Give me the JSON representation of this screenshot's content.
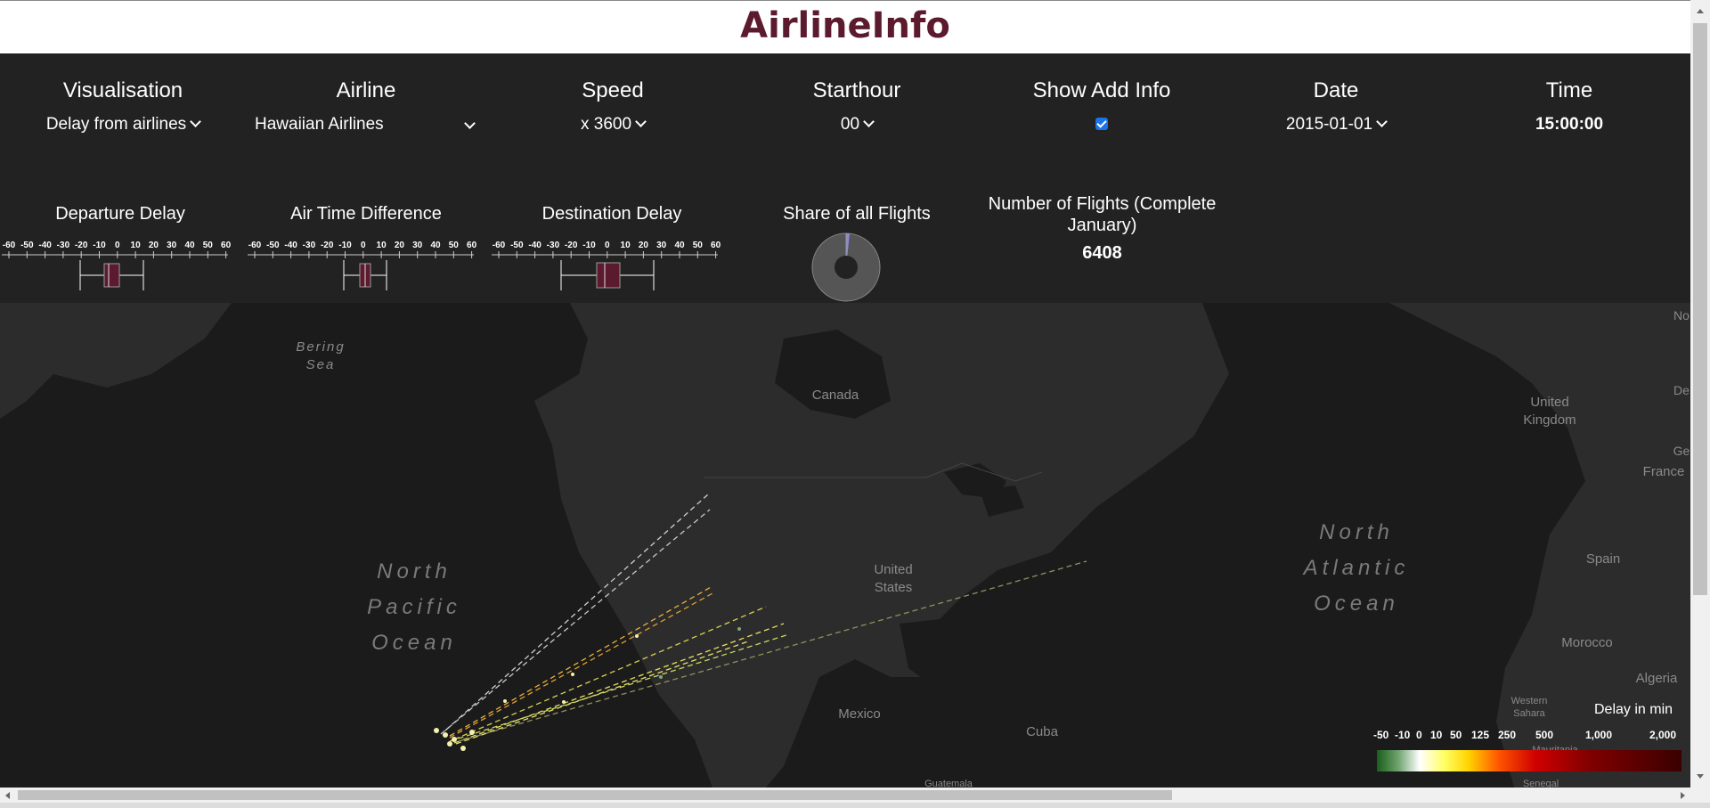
{
  "app": {
    "title": "AirlineInfo"
  },
  "controls": {
    "visualisation": {
      "label": "Visualisation",
      "value": "Delay from airlines"
    },
    "airline": {
      "label": "Airline",
      "value": "Hawaiian Airlines"
    },
    "speed": {
      "label": "Speed",
      "value": "x 3600"
    },
    "starthour": {
      "label": "Starthour",
      "value": "00"
    },
    "show_add_info": {
      "label": "Show Add Info",
      "checked": true
    },
    "date": {
      "label": "Date",
      "value": "2015-01-01"
    },
    "time": {
      "label": "Time",
      "value": "15:00:00"
    }
  },
  "stats": {
    "departure_delay": {
      "label": "Departure Delay"
    },
    "air_time_difference": {
      "label": "Air Time Difference"
    },
    "destination_delay": {
      "label": "Destination Delay"
    },
    "share": {
      "label": "Share of all Flights"
    },
    "num_flights": {
      "label": "Number of Flights (Complete January)",
      "value": "6408"
    },
    "axis_ticks": [
      "-60",
      "-50",
      "-40",
      "-30",
      "-20",
      "-10",
      "0",
      "10",
      "20",
      "30",
      "40",
      "50",
      "60"
    ]
  },
  "map": {
    "labels": {
      "bering_sea": "Bering Sea",
      "north_pacific": "North Pacific Ocean",
      "north_atlantic": "North Atlantic Ocean",
      "canada": "Canada",
      "united_states": "United States",
      "mexico": "Mexico",
      "cuba": "Cuba",
      "guatemala": "Guatemala",
      "united_kingdom": "United Kingdom",
      "france": "France",
      "spain": "Spain",
      "morocco": "Morocco",
      "algeria": "Algeria",
      "western_sahara": "Western Sahara",
      "mauritania": "Mauritania",
      "senegal": "Senegal",
      "no": "No",
      "de": "De",
      "ge": "Ge"
    }
  },
  "legend": {
    "title": "Delay in min",
    "ticks": [
      "-50",
      "-10",
      "0",
      "10",
      "50",
      "125",
      "250",
      "500",
      "1,000",
      "2,000"
    ]
  },
  "colors": {
    "title": "#5b1a2e",
    "box": "#5b1a2e",
    "panel": "#222222",
    "map": "#1b1b1b"
  }
}
